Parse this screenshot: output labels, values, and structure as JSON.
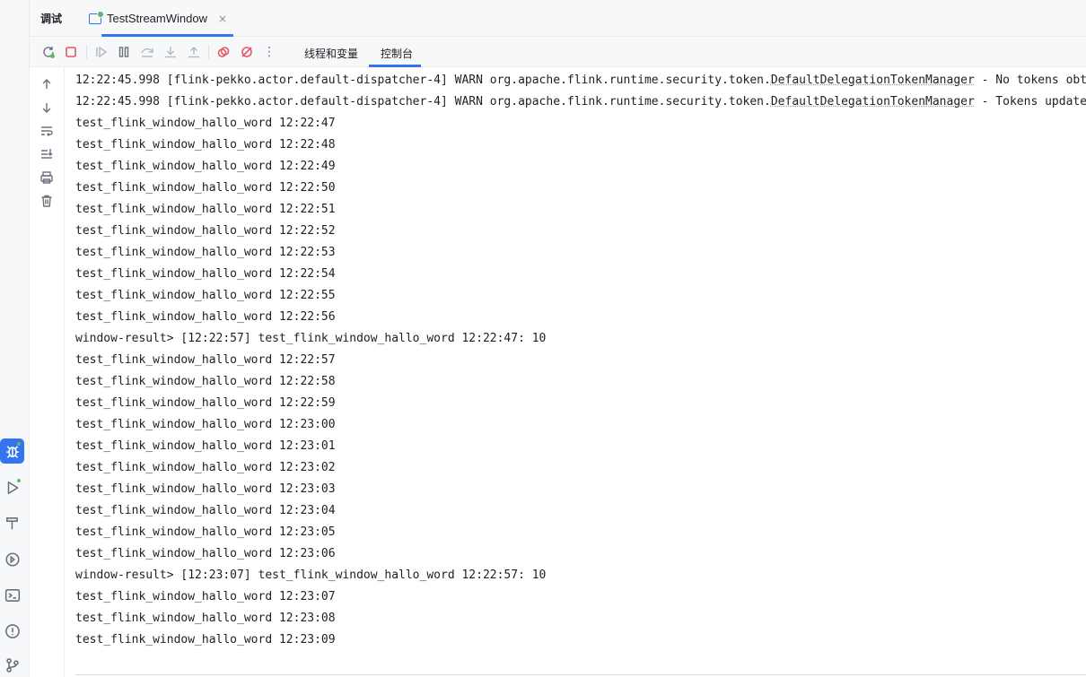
{
  "header": {
    "title": "调试",
    "tab_label": "TestStreamWindow",
    "tab_close": "×"
  },
  "toolbar": {
    "more": "⋮",
    "tab_threads": "线程和变量",
    "tab_console": "控制台"
  },
  "colors": {
    "accent": "#3574f0",
    "stop_red": "#e55765",
    "status_green": "#5fb865"
  },
  "console": {
    "warn_lines": [
      {
        "prefix": "12:22:45.998 [flink-pekko.actor.default-dispatcher-4] WARN org.apache.flink.runtime.security.token.",
        "cls": "DefaultDelegationTokenManager",
        "suffix": " - No tokens obtained so far, skipping."
      },
      {
        "prefix": "12:22:45.998 [flink-pekko.actor.default-dispatcher-4] WARN org.apache.flink.runtime.security.token.",
        "cls": "DefaultDelegationTokenManager",
        "suffix": " - Tokens update task not started."
      }
    ],
    "lines": [
      "test_flink_window_hallo_word 12:22:47",
      "test_flink_window_hallo_word 12:22:48",
      "test_flink_window_hallo_word 12:22:49",
      "test_flink_window_hallo_word 12:22:50",
      "test_flink_window_hallo_word 12:22:51",
      "test_flink_window_hallo_word 12:22:52",
      "test_flink_window_hallo_word 12:22:53",
      "test_flink_window_hallo_word 12:22:54",
      "test_flink_window_hallo_word 12:22:55",
      "test_flink_window_hallo_word 12:22:56",
      "window-result> [12:22:57] test_flink_window_hallo_word 12:22:47: 10",
      "test_flink_window_hallo_word 12:22:57",
      "test_flink_window_hallo_word 12:22:58",
      "test_flink_window_hallo_word 12:22:59",
      "test_flink_window_hallo_word 12:23:00",
      "test_flink_window_hallo_word 12:23:01",
      "test_flink_window_hallo_word 12:23:02",
      "test_flink_window_hallo_word 12:23:03",
      "test_flink_window_hallo_word 12:23:04",
      "test_flink_window_hallo_word 12:23:05",
      "test_flink_window_hallo_word 12:23:06",
      "window-result> [12:23:07] test_flink_window_hallo_word 12:22:57: 10",
      "test_flink_window_hallo_word 12:23:07",
      "test_flink_window_hallo_word 12:23:08",
      "test_flink_window_hallo_word 12:23:09"
    ]
  },
  "left_strip_icons": [
    "debug-icon",
    "run-icon",
    "build-hammer-icon",
    "services-icon",
    "terminal-icon",
    "problems-icon",
    "git-icon"
  ],
  "gutter_icons": [
    "scroll-up-icon",
    "scroll-down-icon",
    "soft-wrap-icon",
    "scroll-to-end-icon",
    "print-icon",
    "clear-all-icon"
  ]
}
